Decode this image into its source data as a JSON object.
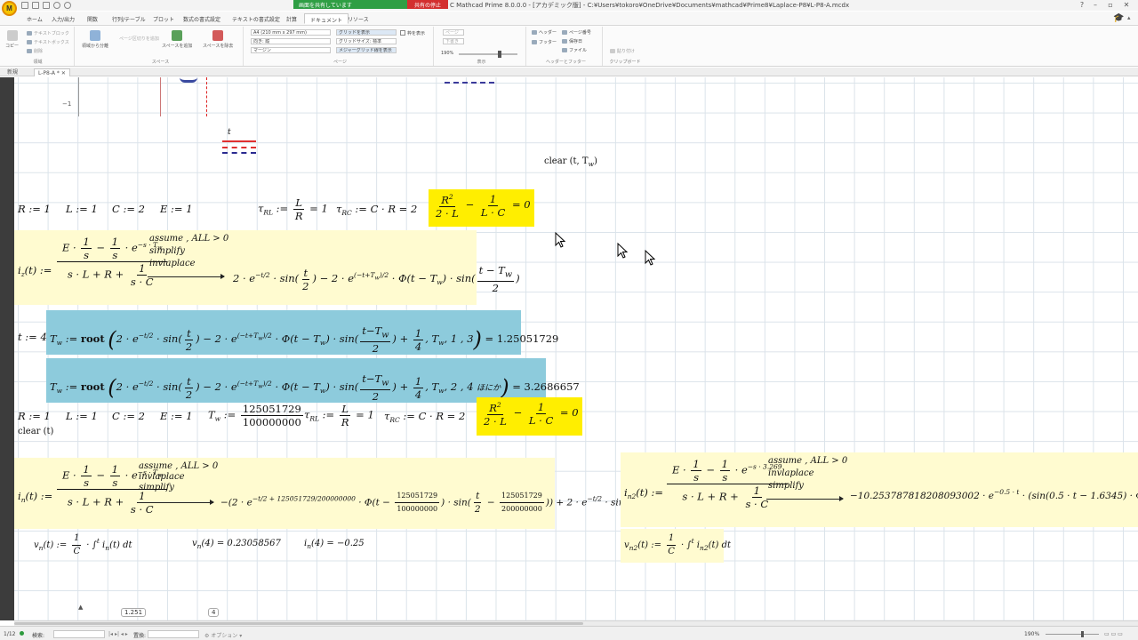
{
  "titlebar": {
    "app_logo": "M",
    "share_label": "画面を共有しています",
    "stop_label": "共有の停止",
    "window_title": "C Mathcad Prime 8.0.0.0 - [アカデミック版] - C:¥Users¥tokoro¥OneDrive¥Documents¥mathcad¥Prime8¥Laplace-P8¥L-P8-A.mcdx"
  },
  "ribbon": {
    "tabs": [
      "ホーム",
      "入力/出力",
      "関数",
      "行列/テーブル",
      "プロット",
      "数式の書式設定",
      "テキストの書式設定",
      "計算",
      "ドキュメント",
      "リソース"
    ],
    "active_tab": "ドキュメント",
    "groups": {
      "region": {
        "label": "領域",
        "copy": "コピー",
        "text_block": "テキストブロック",
        "text_box": "テキストボックス",
        "delete": "削除"
      },
      "space": {
        "label": "スペース",
        "split": "領域から分離",
        "page_break": "ページ区切りを追加",
        "add_space": "スペースを追加",
        "remove_space": "スペースを除去"
      },
      "page": {
        "label": "ページ",
        "paper": "A4 (210 mm x 297 mm)",
        "orientation": "向き: 縦",
        "margin": "マージン",
        "show_grid": "グリッドを表示",
        "grid_size": "グリッドサイズ: 標準",
        "major_grid": "メジャーグリッド線を表示",
        "show_frame": "枠を表示"
      },
      "view": {
        "label": "表示",
        "page_view": "ページ",
        "draft_view": "下書き",
        "zoom": "190%"
      },
      "header_footer": {
        "label": "ヘッダーとフッター",
        "header": "ヘッダー",
        "footer": "フッター",
        "page_number": "ページ番号",
        "save_date": "保存日",
        "file": "ファイル"
      },
      "clipboard": {
        "label": "クリップボード",
        "paste": "貼り付け"
      }
    }
  },
  "doc_tabs": {
    "new": "新規",
    "current": "L-P8-A *"
  },
  "worksheet": {
    "axis_tick": "−1",
    "legend_label": "t",
    "clear1": "clear (t, T",
    "clear1_sub": "w",
    "row1": {
      "R": "R := 1",
      "L": "L := 1",
      "C": "C := 2",
      "E": "E := 1"
    },
    "tau_rl": "τ",
    "tau_rl_sub": "RL",
    "tau_rl_tail": "= 1",
    "tau_rc": "τ",
    "tau_rc_sub": "RC",
    "tau_rc_expr": ":= C · R = 2",
    "cond_result": "= 0",
    "iz_label": "i",
    "iz_sub": "z",
    "iz_kw1": "assume , ALL > 0",
    "iz_kw2": "simplify",
    "iz_kw3": "invlaplace",
    "t_assign": "t := 4",
    "root1_result": "= 1.25051729",
    "root2_result": "= 3.2686657",
    "root2_args": ", T",
    "root2_args_tail": ", 2 , 4",
    "root2_comment": "ほにか",
    "root1_args": ", T",
    "root1_args_tail": ", 1 , 3",
    "row2": {
      "R": "R := 1",
      "L": "L := 1",
      "C": "C := 2",
      "E": "E := 1"
    },
    "tw_num": "125051729",
    "tw_den": "100000000",
    "clear2": "clear (t)",
    "in_label": "i",
    "in_sub": "n",
    "in_kw1": "assume , ALL > 0",
    "in_kw2": "invlaplace",
    "in_kw3": "simplify",
    "in_c1": "125051729",
    "in_c2": "200000000",
    "in_c3": "125051729",
    "in_c4": "100000000",
    "in_c5": "125051729",
    "in_c6": "200000000",
    "vn_def": "v",
    "vn_val": "(4) = 0.23058567",
    "in_val": "(4) = −0.25",
    "in2_label": "i",
    "in2_sub": "n2",
    "in2_kw1": "assume , ALL > 0",
    "in2_kw2": "invlaplace",
    "in2_kw3": "simplify",
    "in2_exp": "−s · 3.269",
    "in2_result": "−10.253787818208093002 · e",
    "in2_result_exp": "−0.5 · t",
    "in2_result_tail": "· (sin(0.5 · t − 1.6345) · Φ(t",
    "vn2_def": "v",
    "vn2_sub": "n2",
    "bottom_val1": "1.251",
    "bottom_val2": "4"
  },
  "statusbar": {
    "page": "1/12",
    "search_label": "検索:",
    "replace_label": "置換:",
    "options": "オプション",
    "zoom": "190%"
  }
}
